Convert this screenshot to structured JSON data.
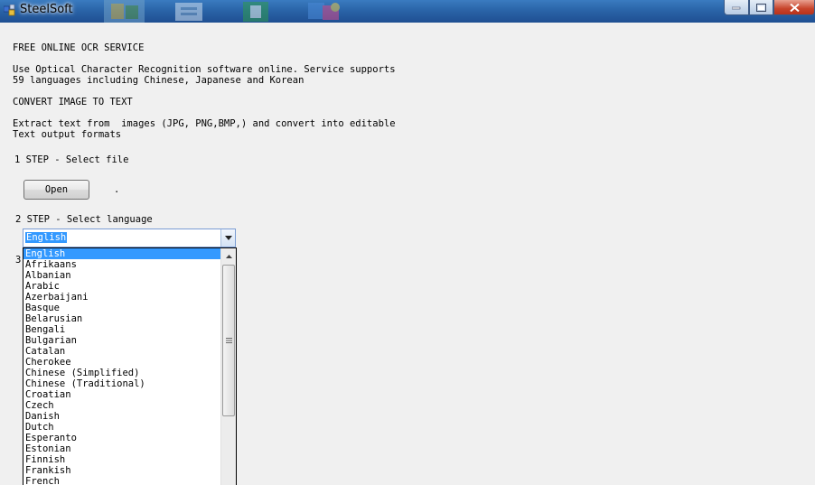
{
  "window": {
    "title": "SteelSoft",
    "controls": {
      "minimize": "minimize",
      "maximize": "maximize",
      "close": "close"
    }
  },
  "content": {
    "heading1": "FREE ONLINE OCR SERVICE",
    "desc1_line1": "Use Optical Character Recognition software online. Service supports",
    "desc1_line2": "59 languages including Chinese, Japanese and Korean",
    "heading2": "CONVERT IMAGE TO TEXT",
    "desc2_line1": "Extract text from  images (JPG, PNG,BMP,) and convert into editable",
    "desc2_line2": "Text output formats",
    "step1_label": "1 STEP - Select file",
    "open_button": "Open",
    "file_status": ".",
    "step2_label": "2 STEP - Select language",
    "step3_label_partial": "3"
  },
  "language_combo": {
    "selected": "English",
    "options": [
      "English",
      "Afrikaans",
      "Albanian",
      "Arabic",
      "Azerbaijani",
      "Basque",
      "Belarusian",
      "Bengali",
      "Bulgarian",
      "Catalan",
      "Cherokee",
      "Chinese (Simplified)",
      "Chinese (Traditional)",
      "Croatian",
      "Czech",
      "Danish",
      "Dutch",
      "Esperanto",
      "Estonian",
      "Finnish",
      "Frankish",
      "French"
    ]
  },
  "colors": {
    "selection": "#3399ff",
    "titlebar": "#2a64a8",
    "background": "#f0f0f0"
  }
}
